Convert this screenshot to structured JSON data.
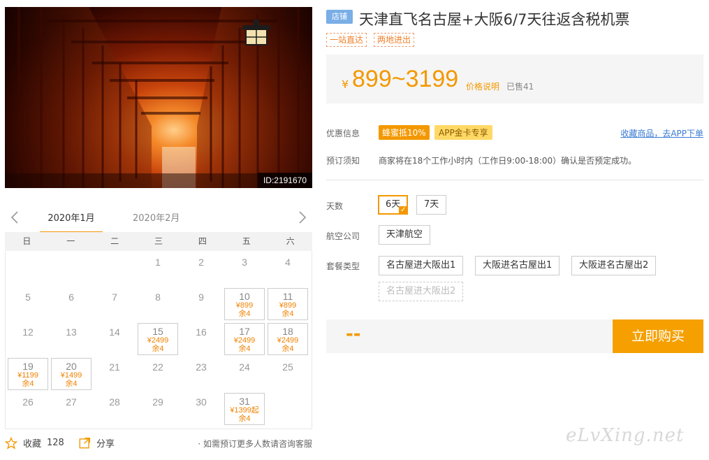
{
  "hero": {
    "id_label": "ID:2191670"
  },
  "calendar": {
    "active_month": "2020年1月",
    "other_month": "2020年2月",
    "weekdays": [
      "日",
      "一",
      "二",
      "三",
      "四",
      "五",
      "六"
    ],
    "days": {
      "d1": {
        "num": "1"
      },
      "d2": {
        "num": "2"
      },
      "d3": {
        "num": "3"
      },
      "d4": {
        "num": "4"
      },
      "d5": {
        "num": "5"
      },
      "d6": {
        "num": "6"
      },
      "d7": {
        "num": "7"
      },
      "d8": {
        "num": "8"
      },
      "d9": {
        "num": "9"
      },
      "d10": {
        "num": "10",
        "price": "¥899",
        "left": "余4"
      },
      "d11": {
        "num": "11",
        "price": "¥899",
        "left": "余4"
      },
      "d12": {
        "num": "12"
      },
      "d13": {
        "num": "13"
      },
      "d14": {
        "num": "14"
      },
      "d15": {
        "num": "15",
        "price": "¥2499",
        "left": "余4"
      },
      "d16": {
        "num": "16"
      },
      "d17": {
        "num": "17",
        "price": "¥2499",
        "left": "余4"
      },
      "d18": {
        "num": "18",
        "price": "¥2499",
        "left": "余4"
      },
      "d19": {
        "num": "19",
        "price": "¥1199",
        "left": "余4"
      },
      "d20": {
        "num": "20",
        "price": "¥1499",
        "left": "余4"
      },
      "d21": {
        "num": "21"
      },
      "d22": {
        "num": "22"
      },
      "d23": {
        "num": "23"
      },
      "d24": {
        "num": "24"
      },
      "d25": {
        "num": "25"
      },
      "d26": {
        "num": "26"
      },
      "d27": {
        "num": "27"
      },
      "d28": {
        "num": "28"
      },
      "d29": {
        "num": "29"
      },
      "d30": {
        "num": "30"
      },
      "d31": {
        "num": "31",
        "price": "¥1399起",
        "left": "余4"
      }
    }
  },
  "footer": {
    "favorite_label": "收藏",
    "favorite_count": "128",
    "share_label": "分享",
    "note": "· 如需预订更多人数请咨询客服"
  },
  "product": {
    "shop_badge": "店铺",
    "title": "天津直飞名古屋+大阪6/7天往返含税机票",
    "tags": [
      "一站直达",
      "两地进出"
    ],
    "price_yen": "¥",
    "price_range": "899~3199",
    "price_explain": "价格说明",
    "sold": "已售41"
  },
  "promo": {
    "label": "优惠信息",
    "badge1": "蜂蜜抵10%",
    "badge2": "APP金卡专享",
    "collect": "收藏商品，去APP下单"
  },
  "notice": {
    "label": "预订须知",
    "text": "商家将在18个工作小时内（工作日9:00-18:00）确认是否预定成功。"
  },
  "options": {
    "days_label": "天数",
    "days": [
      "6天",
      "7天"
    ],
    "days_selected": "6天",
    "airline_label": "航空公司",
    "airline": "天津航空",
    "package_label": "套餐类型",
    "packages": [
      "名古屋进大阪出1",
      "大阪进名古屋出1",
      "大阪进名古屋出2",
      "名古屋进大阪出2"
    ]
  },
  "buy": {
    "total": "--",
    "button": "立即购买"
  },
  "watermark": "eLvXing.net",
  "colors": {
    "accent": "#f39800",
    "link": "#3a7bd5",
    "badge": "#7aaee6"
  }
}
